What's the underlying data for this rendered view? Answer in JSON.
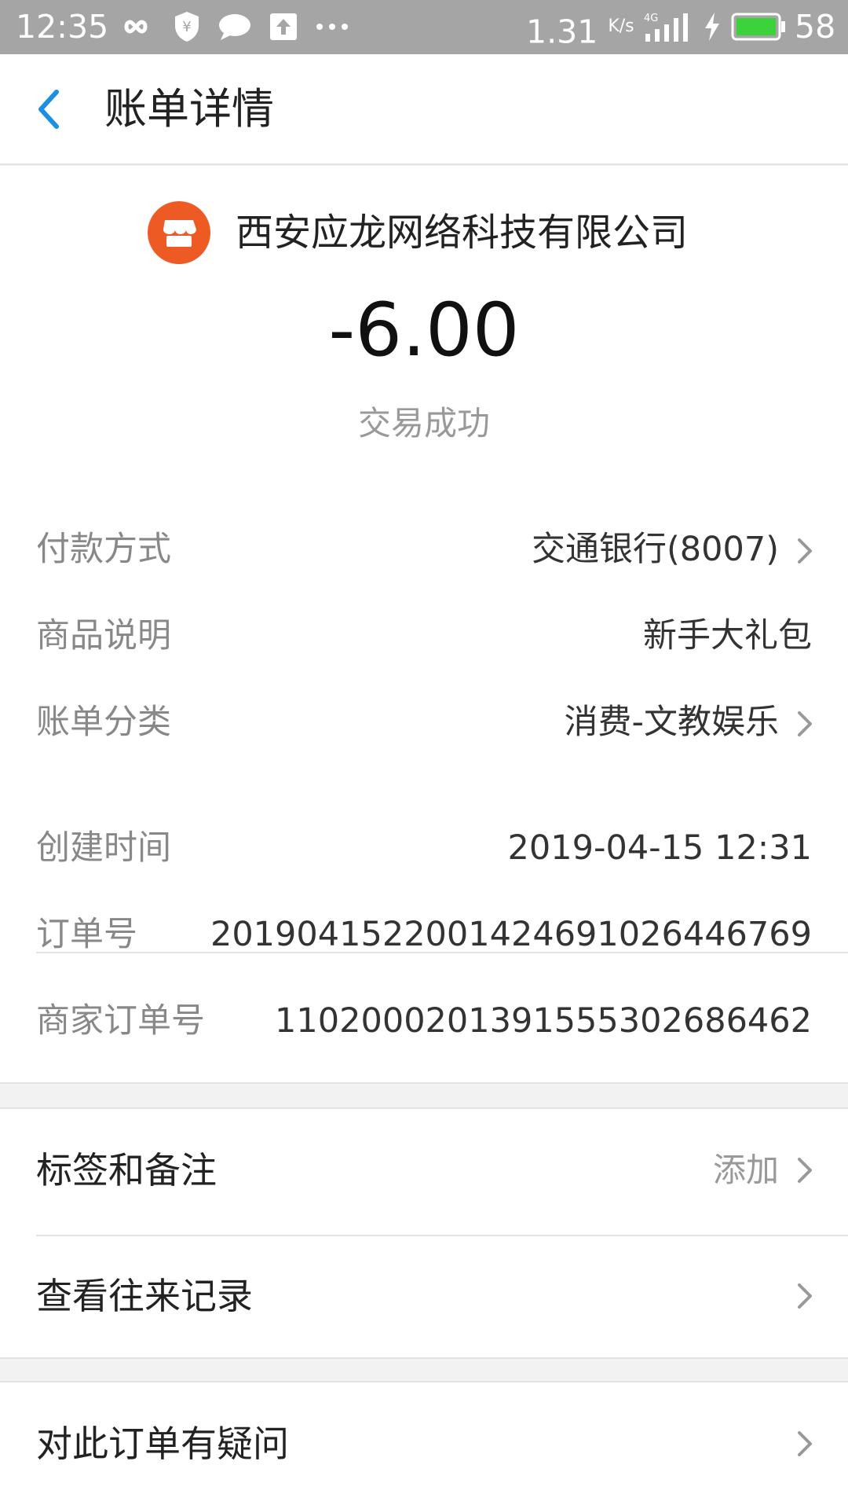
{
  "status_bar": {
    "time": "12:35",
    "net_speed": "1.31",
    "net_speed_unit": "K/s",
    "network": "4G",
    "battery": "58",
    "icons": [
      "infinity-icon",
      "shield-yen-icon",
      "chat-bubble-icon",
      "upload-icon",
      "more-dots-icon",
      "signal-icon",
      "charging-icon",
      "battery-icon"
    ]
  },
  "header": {
    "title": "账单详情"
  },
  "bill": {
    "merchant": "西安应龙网络科技有限公司",
    "amount": "-6.00",
    "status": "交易成功",
    "details": [
      {
        "label": "付款方式",
        "value": "交通银行(8007)",
        "arrow": true
      },
      {
        "label": "商品说明",
        "value": "新手大礼包",
        "arrow": false
      },
      {
        "label": "账单分类",
        "value": "消费-文教娱乐",
        "arrow": true
      }
    ],
    "order_info": [
      {
        "label": "创建时间",
        "value": "2019-04-15 12:31"
      },
      {
        "label": "订单号",
        "value": "2019041522001424691026446769"
      },
      {
        "label": "商家订单号",
        "value": "1102000201391555302686462"
      }
    ]
  },
  "actions": {
    "tags_label": "标签和备注",
    "tags_hint": "添加",
    "history_label": "查看往来记录",
    "question_label": "对此订单有疑问"
  },
  "colors": {
    "accent": "#1a8fe3",
    "merchant_logo": "#ee5a24",
    "status_bar": "#a5a5a5",
    "battery_fill": "#3bd23b"
  }
}
